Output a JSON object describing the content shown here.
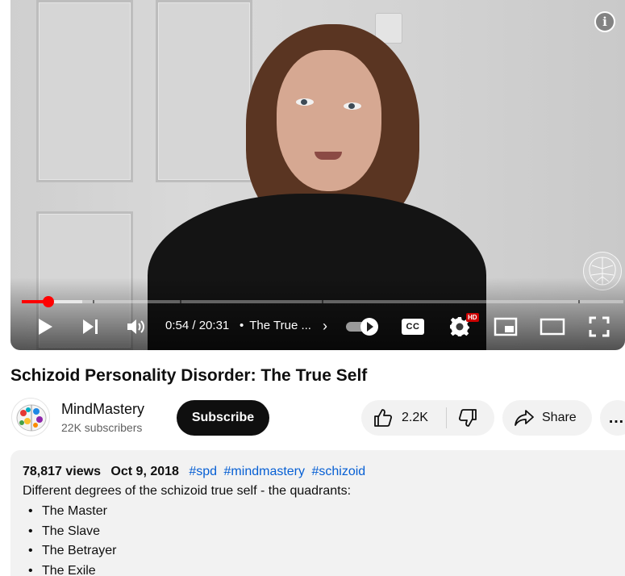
{
  "player": {
    "current_time": "0:54",
    "duration": "20:31",
    "time_separator": "/",
    "chapter_title": "The True ...",
    "progress_fraction": 0.044,
    "buffered_fraction": 0.1,
    "info_label": "i",
    "cc_label": "CC",
    "hd_badge": "HD",
    "autoplay_on": true,
    "icons": {
      "info": "info-icon",
      "play": "play-icon",
      "next": "next-icon",
      "volume": "volume-icon",
      "autoplay": "autoplay-toggle-icon",
      "captions": "captions-icon",
      "settings": "settings-gear-icon",
      "miniplayer": "miniplayer-icon",
      "theater": "theater-mode-icon",
      "fullscreen": "fullscreen-icon"
    }
  },
  "video": {
    "title": "Schizoid Personality Disorder: The True Self"
  },
  "channel": {
    "name": "MindMastery",
    "subscribers": "22K subscribers",
    "subscribe_label": "Subscribe"
  },
  "actions": {
    "like_count": "2.2K",
    "share_label": "Share",
    "more_label": "…"
  },
  "description": {
    "views": "78,817 views",
    "date": "Oct 9, 2018",
    "hashtags": [
      "#spd",
      "#mindmastery",
      "#schizoid"
    ],
    "text": "Different degrees of the schizoid true self - the quadrants:",
    "list": [
      "The Master",
      "The Slave",
      "The Betrayer",
      "The Exile"
    ]
  },
  "colors": {
    "accent_red": "#ff0000",
    "link_blue": "#065fd4",
    "button_dark": "#0f0f0f",
    "pill_bg": "#f2f2f2",
    "secondary_text": "#606060"
  }
}
